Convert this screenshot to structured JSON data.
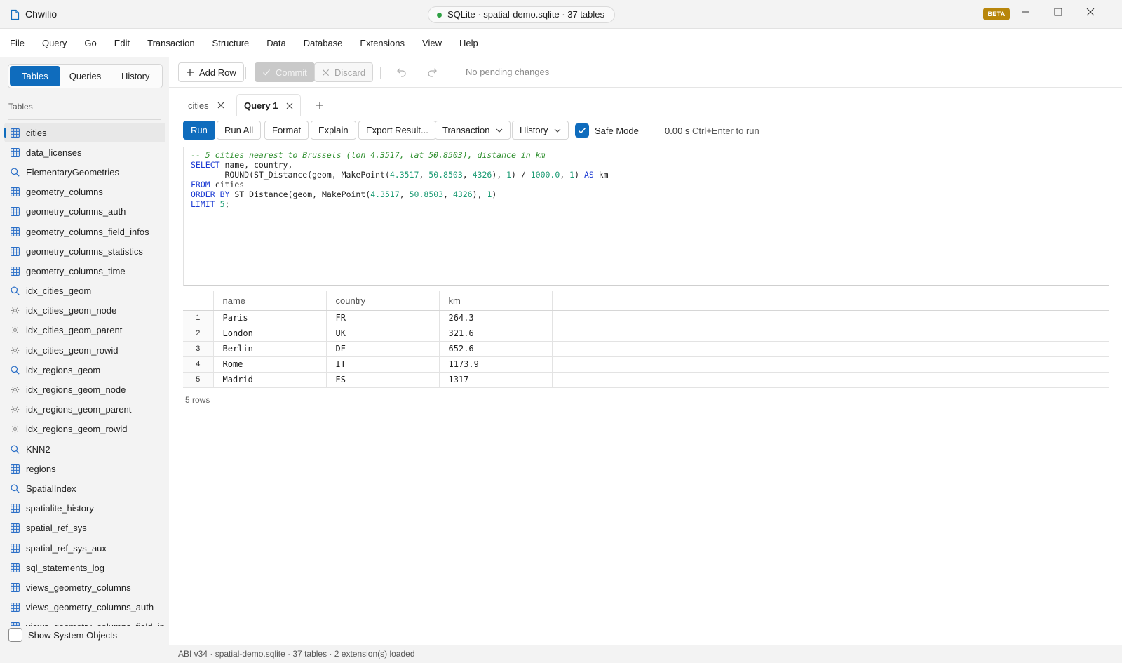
{
  "titlebar": {
    "app_name": "Chwilio",
    "connection": "SQLite · spatial-demo.sqlite · 37 tables",
    "badge": "BETA",
    "accent": "#0f6cbd"
  },
  "menu": [
    "File",
    "Query",
    "Go",
    "Edit",
    "Transaction",
    "Structure",
    "Data",
    "Database",
    "Extensions",
    "View",
    "Help"
  ],
  "sidebar": {
    "tabs": [
      "Tables",
      "Queries",
      "History"
    ],
    "section_title": "Tables",
    "items": [
      {
        "label": "cities",
        "icon": "table-icon"
      },
      {
        "label": "data_licenses",
        "icon": "table-icon"
      },
      {
        "label": "ElementaryGeometries",
        "icon": "search-icon"
      },
      {
        "label": "geometry_columns",
        "icon": "table-icon"
      },
      {
        "label": "geometry_columns_auth",
        "icon": "table-icon"
      },
      {
        "label": "geometry_columns_field_infos",
        "icon": "table-icon"
      },
      {
        "label": "geometry_columns_statistics",
        "icon": "table-icon"
      },
      {
        "label": "geometry_columns_time",
        "icon": "table-icon"
      },
      {
        "label": "idx_cities_geom",
        "icon": "search-icon"
      },
      {
        "label": "idx_cities_geom_node",
        "icon": "gear-icon"
      },
      {
        "label": "idx_cities_geom_parent",
        "icon": "gear-icon"
      },
      {
        "label": "idx_cities_geom_rowid",
        "icon": "gear-icon"
      },
      {
        "label": "idx_regions_geom",
        "icon": "search-icon"
      },
      {
        "label": "idx_regions_geom_node",
        "icon": "gear-icon"
      },
      {
        "label": "idx_regions_geom_parent",
        "icon": "gear-icon"
      },
      {
        "label": "idx_regions_geom_rowid",
        "icon": "gear-icon"
      },
      {
        "label": "KNN2",
        "icon": "search-icon"
      },
      {
        "label": "regions",
        "icon": "table-icon"
      },
      {
        "label": "SpatialIndex",
        "icon": "search-icon"
      },
      {
        "label": "spatialite_history",
        "icon": "table-icon"
      },
      {
        "label": "spatial_ref_sys",
        "icon": "table-icon"
      },
      {
        "label": "spatial_ref_sys_aux",
        "icon": "table-icon"
      },
      {
        "label": "sql_statements_log",
        "icon": "table-icon"
      },
      {
        "label": "views_geometry_columns",
        "icon": "table-icon"
      },
      {
        "label": "views_geometry_columns_auth",
        "icon": "table-icon"
      },
      {
        "label": "views_geometry_columns_field_info",
        "icon": "table-icon"
      }
    ],
    "show_system_label": "Show System Objects"
  },
  "toolbar": {
    "add_row": "Add Row",
    "commit": "Commit",
    "discard": "Discard",
    "pending": "No pending changes"
  },
  "doc_tabs": [
    {
      "label": "cities"
    },
    {
      "label": "Query 1"
    }
  ],
  "query_toolbar": {
    "run": "Run",
    "run_all": "Run All",
    "format": "Format",
    "explain": "Explain",
    "export": "Export Result...",
    "transaction": "Transaction",
    "history": "History",
    "safe_mode": "Safe Mode",
    "timing": "0.00 s",
    "hint": "Ctrl+Enter to run"
  },
  "editor": {
    "lines": [
      "-- 5 cities nearest to Brussels (lon 4.3517, lat 50.8503), distance in km",
      "SELECT name, country,",
      "       ROUND(ST_Distance(geom, MakePoint(4.3517, 50.8503, 4326), 1) / 1000.0, 1) AS km",
      "FROM cities",
      "ORDER BY ST_Distance(geom, MakePoint(4.3517, 50.8503, 4326), 1)",
      "LIMIT 5;"
    ]
  },
  "results": {
    "columns": [
      "name",
      "country",
      "km"
    ],
    "rows": [
      [
        "1",
        "Paris",
        "FR",
        "264.3"
      ],
      [
        "2",
        "London",
        "UK",
        "321.6"
      ],
      [
        "3",
        "Berlin",
        "DE",
        "652.6"
      ],
      [
        "4",
        "Rome",
        "IT",
        "1173.9"
      ],
      [
        "5",
        "Madrid",
        "ES",
        "1317"
      ]
    ],
    "row_count": "5 rows"
  },
  "statusbar": {
    "text": "ABI v34 · spatial-demo.sqlite · 37 tables · 2 extension(s) loaded"
  }
}
